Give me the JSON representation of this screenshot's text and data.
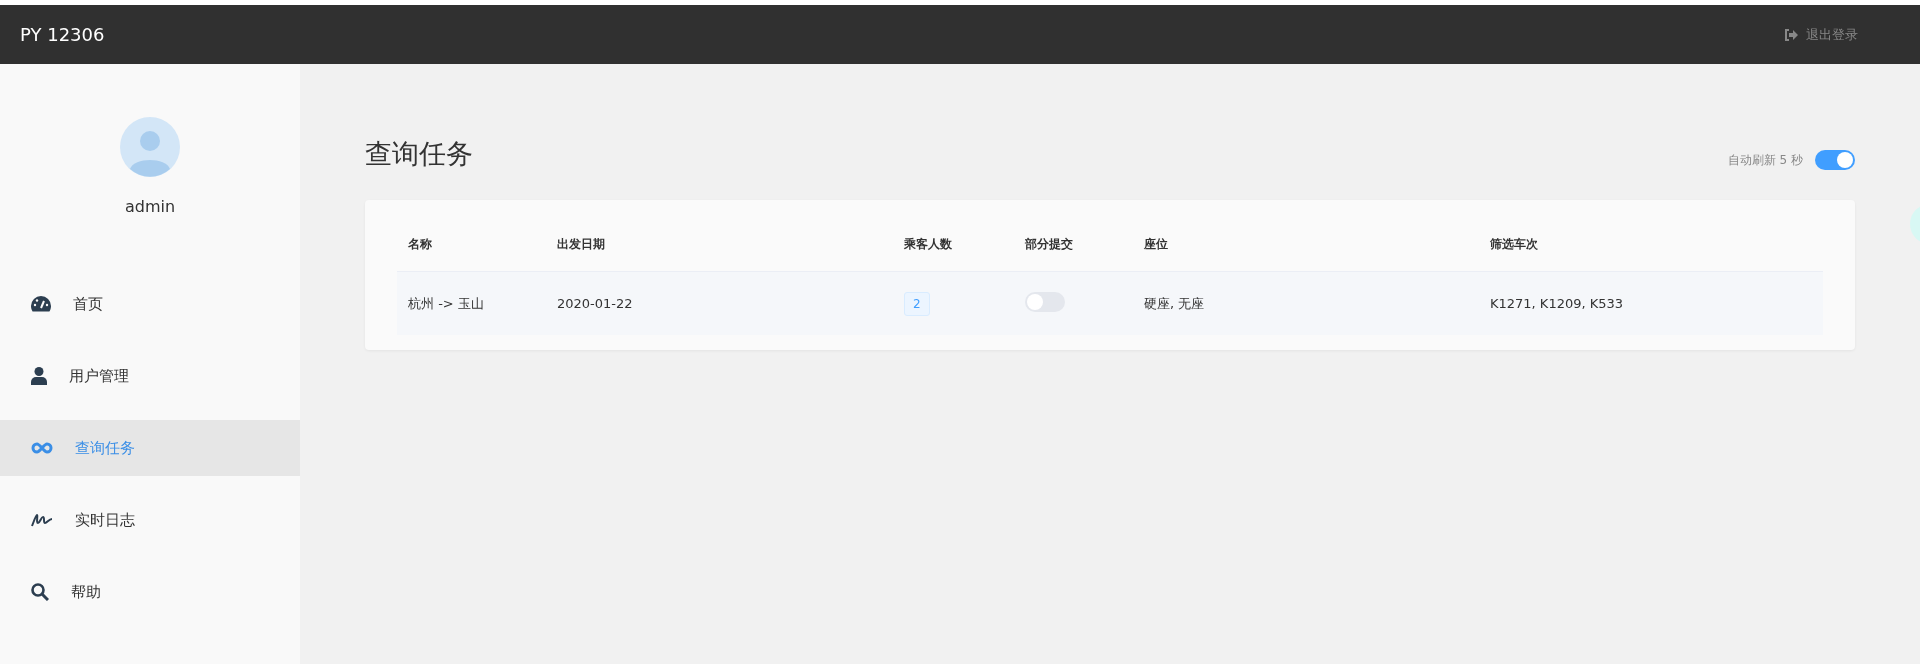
{
  "header": {
    "brand": "PY 12306",
    "logout": "退出登录"
  },
  "sidebar": {
    "user": "admin",
    "items": [
      {
        "label": "首页",
        "selected": false
      },
      {
        "label": "用户管理",
        "selected": false
      },
      {
        "label": "查询任务",
        "selected": true
      },
      {
        "label": "实时日志",
        "selected": false
      },
      {
        "label": "帮助",
        "selected": false
      }
    ]
  },
  "page": {
    "title": "查询任务",
    "auto_refresh": {
      "label": "自动刷新 5 秒",
      "on": true
    }
  },
  "table": {
    "columns": [
      "名称",
      "出发日期",
      "乘客人数",
      "部分提交",
      "座位",
      "筛选车次"
    ],
    "rows": [
      {
        "name": "杭州 -> 玉山",
        "date": "2020-01-22",
        "passengers": "2",
        "partial_submit": false,
        "seats": "硬座, 无座",
        "trains": "K1271, K1209, K533"
      }
    ]
  }
}
